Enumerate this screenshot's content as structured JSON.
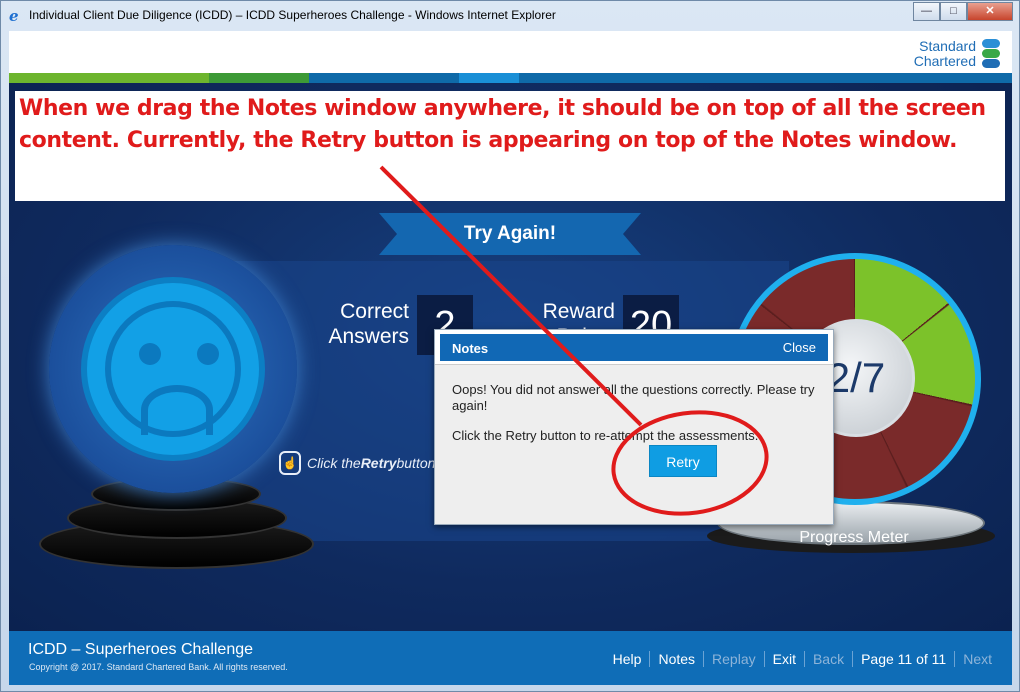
{
  "window": {
    "title": "Individual Client Due Diligence (ICDD) – ICDD Superheroes Challenge - Windows Internet Explorer",
    "icon": "ie-icon",
    "controls": {
      "minimize": "—",
      "maximize": "□",
      "close": "✕"
    }
  },
  "brand": {
    "logo_line1": "Standard",
    "logo_line2": "Chartered",
    "colors": [
      "#6db52e",
      "#3d9a36",
      "#0f6aa8",
      "#1a8fd6",
      "#0f6aa8"
    ]
  },
  "annotation": {
    "text": "When we drag the Notes window anywhere, it should be on top of all the screen content. Currently, the Retry button is appearing on top of the Notes window."
  },
  "result": {
    "banner": "Try Again!",
    "correct_label_1": "Correct",
    "correct_label_2": "Answers",
    "correct_value": "2",
    "reward_label_1": "Reward",
    "reward_label_2": "Points",
    "reward_value": "20",
    "hint_text_pre": "Click the ",
    "hint_text_bold": "Retry",
    "hint_text_post": " button to re-attempt the assessments."
  },
  "meter": {
    "value": "2/7",
    "label": "Progress Meter",
    "correct": 2,
    "total": 7,
    "color_correct": "#7cc22a",
    "color_wrong": "#7a2a2a"
  },
  "notes_dialog": {
    "title": "Notes",
    "close": "Close",
    "line1": "Oops! You did not answer all the questions correctly. Please try again!",
    "line2": "Click the Retry button to re-attempt the assessments."
  },
  "retry_button": {
    "label": "Retry"
  },
  "footer": {
    "title": "ICDD – Superheroes Challenge",
    "copyright": "Copyright @ 2017. Standard Chartered Bank. All rights reserved.",
    "nav": {
      "help": "Help",
      "notes": "Notes",
      "replay": "Replay",
      "exit": "Exit",
      "back": "Back",
      "page": "Page 11 of 11",
      "next": "Next"
    }
  }
}
